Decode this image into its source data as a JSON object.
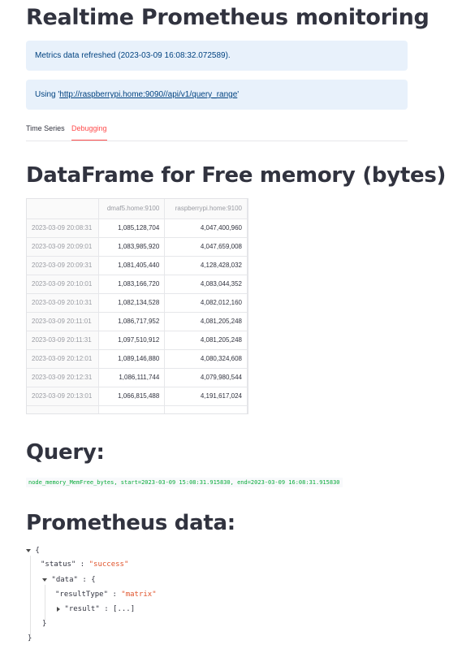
{
  "page": {
    "title": "Realtime Prometheus monitoring"
  },
  "alerts": {
    "refreshed": "Metrics data refreshed (2023-03-09 16:08:32.072589).",
    "using_prefix": "Using '",
    "using_link": "http://raspberrypi.home:9090//api/v1/query_range",
    "using_suffix": "'"
  },
  "tabs": [
    {
      "label": "Time Series",
      "active": false
    },
    {
      "label": "Debugging",
      "active": true
    }
  ],
  "dataframe": {
    "heading": "DataFrame for Free memory (bytes)",
    "columns": [
      "",
      "dmaf5.home:9100",
      "raspberrypi.home:9100"
    ],
    "rows": [
      [
        "2023-03-09 20:08:31",
        "1,085,128,704",
        "4,047,400,960"
      ],
      [
        "2023-03-09 20:09:01",
        "1,083,985,920",
        "4,047,659,008"
      ],
      [
        "2023-03-09 20:09:31",
        "1,081,405,440",
        "4,128,428,032"
      ],
      [
        "2023-03-09 20:10:01",
        "1,083,166,720",
        "4,083,044,352"
      ],
      [
        "2023-03-09 20:10:31",
        "1,082,134,528",
        "4,082,012,160"
      ],
      [
        "2023-03-09 20:11:01",
        "1,086,717,952",
        "4,081,205,248"
      ],
      [
        "2023-03-09 20:11:31",
        "1,097,510,912",
        "4,081,205,248"
      ],
      [
        "2023-03-09 20:12:01",
        "1,089,146,880",
        "4,080,324,608"
      ],
      [
        "2023-03-09 20:12:31",
        "1,086,111,744",
        "4,079,980,544"
      ],
      [
        "2023-03-09 20:13:01",
        "1,066,815,488",
        "4,191,617,024"
      ]
    ]
  },
  "query": {
    "heading": "Query:",
    "code": "node_memory_MemFree_bytes, start=2023-03-09 15:08:31.915830, end=2023-03-09 16:08:31.915830"
  },
  "prometheus": {
    "heading": "Prometheus data:",
    "open_brace": "{",
    "status_key": "\"status\"",
    "status_value": "\"success\"",
    "data_key": "\"data\"",
    "resulttype_key": "\"resultType\"",
    "resulttype_value": "\"matrix\"",
    "result_key": "\"result\"",
    "result_collapsed": "[...]",
    "colon": ":",
    "close_inner": "}",
    "close_outer": "}"
  }
}
